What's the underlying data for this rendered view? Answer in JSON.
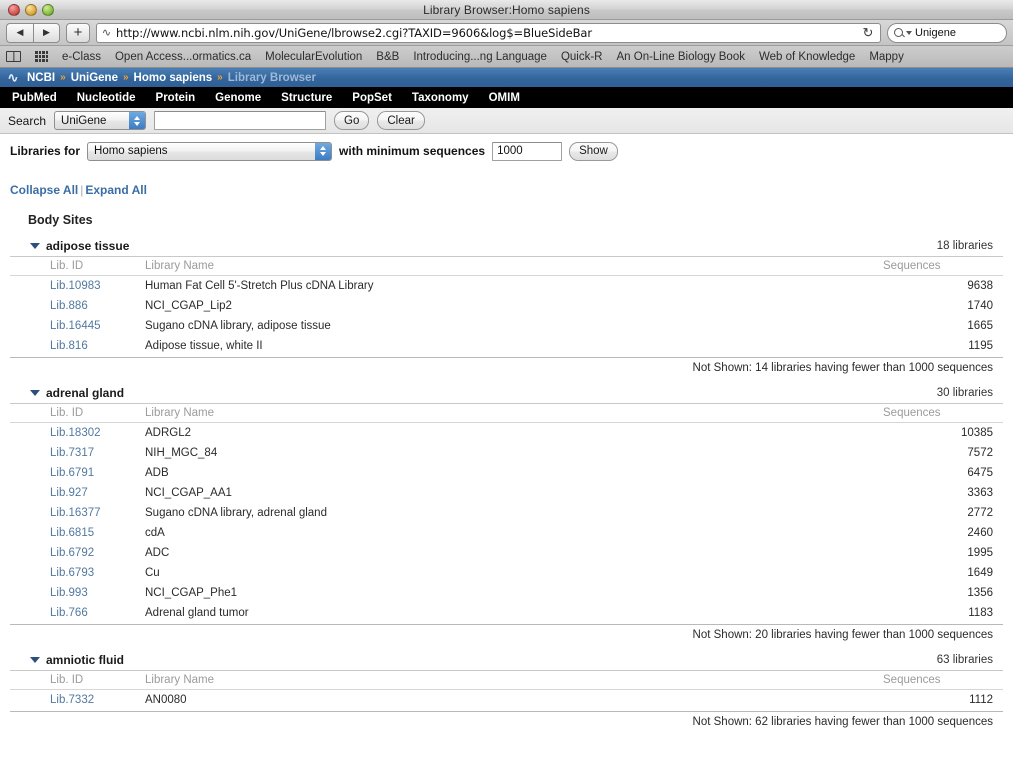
{
  "window": {
    "title": "Library Browser:Homo sapiens",
    "traffic_lights": [
      "close",
      "minimize",
      "zoom"
    ]
  },
  "toolbar": {
    "back_icon": "back-arrow-icon",
    "forward_icon": "forward-arrow-icon",
    "new_tab_label": "+",
    "url": "http://www.ncbi.nlm.nih.gov/UniGene/lbrowse2.cgi?TAXID=9606&log$=BlueSideBar",
    "reload_icon": "reload-icon",
    "search_value": "Unigene",
    "search_icon": "magnifier-icon"
  },
  "bookmarks": {
    "icons": [
      "book-icon",
      "grid-icon"
    ],
    "items": [
      "e-Class",
      "Open Access...ormatics.ca",
      "MolecularEvolution",
      "B&B",
      "Introducing...ng Language",
      "Quick-R",
      "An On-Line Biology Book",
      "Web of Knowledge",
      "Mappy"
    ]
  },
  "ncbi_bar": {
    "logo": "ncbi-dna-logo",
    "crumbs": [
      "NCBI",
      "UniGene",
      "Homo sapiens",
      "Library Browser"
    ],
    "separator": "»",
    "current_index": 3
  },
  "ncbi_nav": {
    "items": [
      "PubMed",
      "Nucleotide",
      "Protein",
      "Genome",
      "Structure",
      "PopSet",
      "Taxonomy",
      "OMIM"
    ]
  },
  "search_strip": {
    "label": "Search",
    "database": "UniGene",
    "query_value": "",
    "query_placeholder": "",
    "go_label": "Go",
    "clear_label": "Clear"
  },
  "filter_strip": {
    "label": "Libraries for",
    "organism": "Homo sapiens",
    "min_label": "with minimum sequences",
    "min_value": "1000",
    "show_label": "Show"
  },
  "page": {
    "collapse_all": "Collapse All",
    "expand_all": "Expand All",
    "separator": "|",
    "section_title": "Body Sites"
  },
  "table_headers": {
    "id": "Lib. ID",
    "name": "Library Name",
    "sequences": "Sequences"
  },
  "body_sites": [
    {
      "name": "adipose tissue",
      "count": "18 libraries",
      "expanded": true,
      "rows": [
        {
          "id": "Lib.10983",
          "name": "Human Fat Cell 5'-Stretch Plus cDNA Library",
          "sequences": "9638"
        },
        {
          "id": "Lib.886",
          "name": "NCI_CGAP_Lip2",
          "sequences": "1740"
        },
        {
          "id": "Lib.16445",
          "name": "Sugano cDNA library, adipose tissue",
          "sequences": "1665"
        },
        {
          "id": "Lib.816",
          "name": "Adipose tissue, white II",
          "sequences": "1195"
        }
      ],
      "not_shown": "Not Shown: 14 libraries having fewer than 1000 sequences"
    },
    {
      "name": "adrenal gland",
      "count": "30 libraries",
      "expanded": true,
      "rows": [
        {
          "id": "Lib.18302",
          "name": "ADRGL2",
          "sequences": "10385"
        },
        {
          "id": "Lib.7317",
          "name": "NIH_MGC_84",
          "sequences": "7572"
        },
        {
          "id": "Lib.6791",
          "name": "ADB",
          "sequences": "6475"
        },
        {
          "id": "Lib.927",
          "name": "NCI_CGAP_AA1",
          "sequences": "3363"
        },
        {
          "id": "Lib.16377",
          "name": "Sugano cDNA library, adrenal gland",
          "sequences": "2772"
        },
        {
          "id": "Lib.6815",
          "name": "cdA",
          "sequences": "2460"
        },
        {
          "id": "Lib.6792",
          "name": "ADC",
          "sequences": "1995"
        },
        {
          "id": "Lib.6793",
          "name": "Cu",
          "sequences": "1649"
        },
        {
          "id": "Lib.993",
          "name": "NCI_CGAP_Phe1",
          "sequences": "1356"
        },
        {
          "id": "Lib.766",
          "name": "Adrenal gland tumor",
          "sequences": "1183"
        }
      ],
      "not_shown": "Not Shown: 20 libraries having fewer than 1000 sequences"
    },
    {
      "name": "amniotic fluid",
      "count": "63 libraries",
      "expanded": true,
      "rows": [
        {
          "id": "Lib.7332",
          "name": "AN0080",
          "sequences": "1112"
        }
      ],
      "not_shown": "Not Shown: 62 libraries having fewer than 1000 sequences"
    }
  ],
  "colors": {
    "link": "#52799f",
    "accent_link": "#3a6ea5",
    "ncbi_bar": "#33659c",
    "ncbi_nav": "#000000",
    "crumb_sep": "#f0a030",
    "muted": "#9b9b9b"
  }
}
